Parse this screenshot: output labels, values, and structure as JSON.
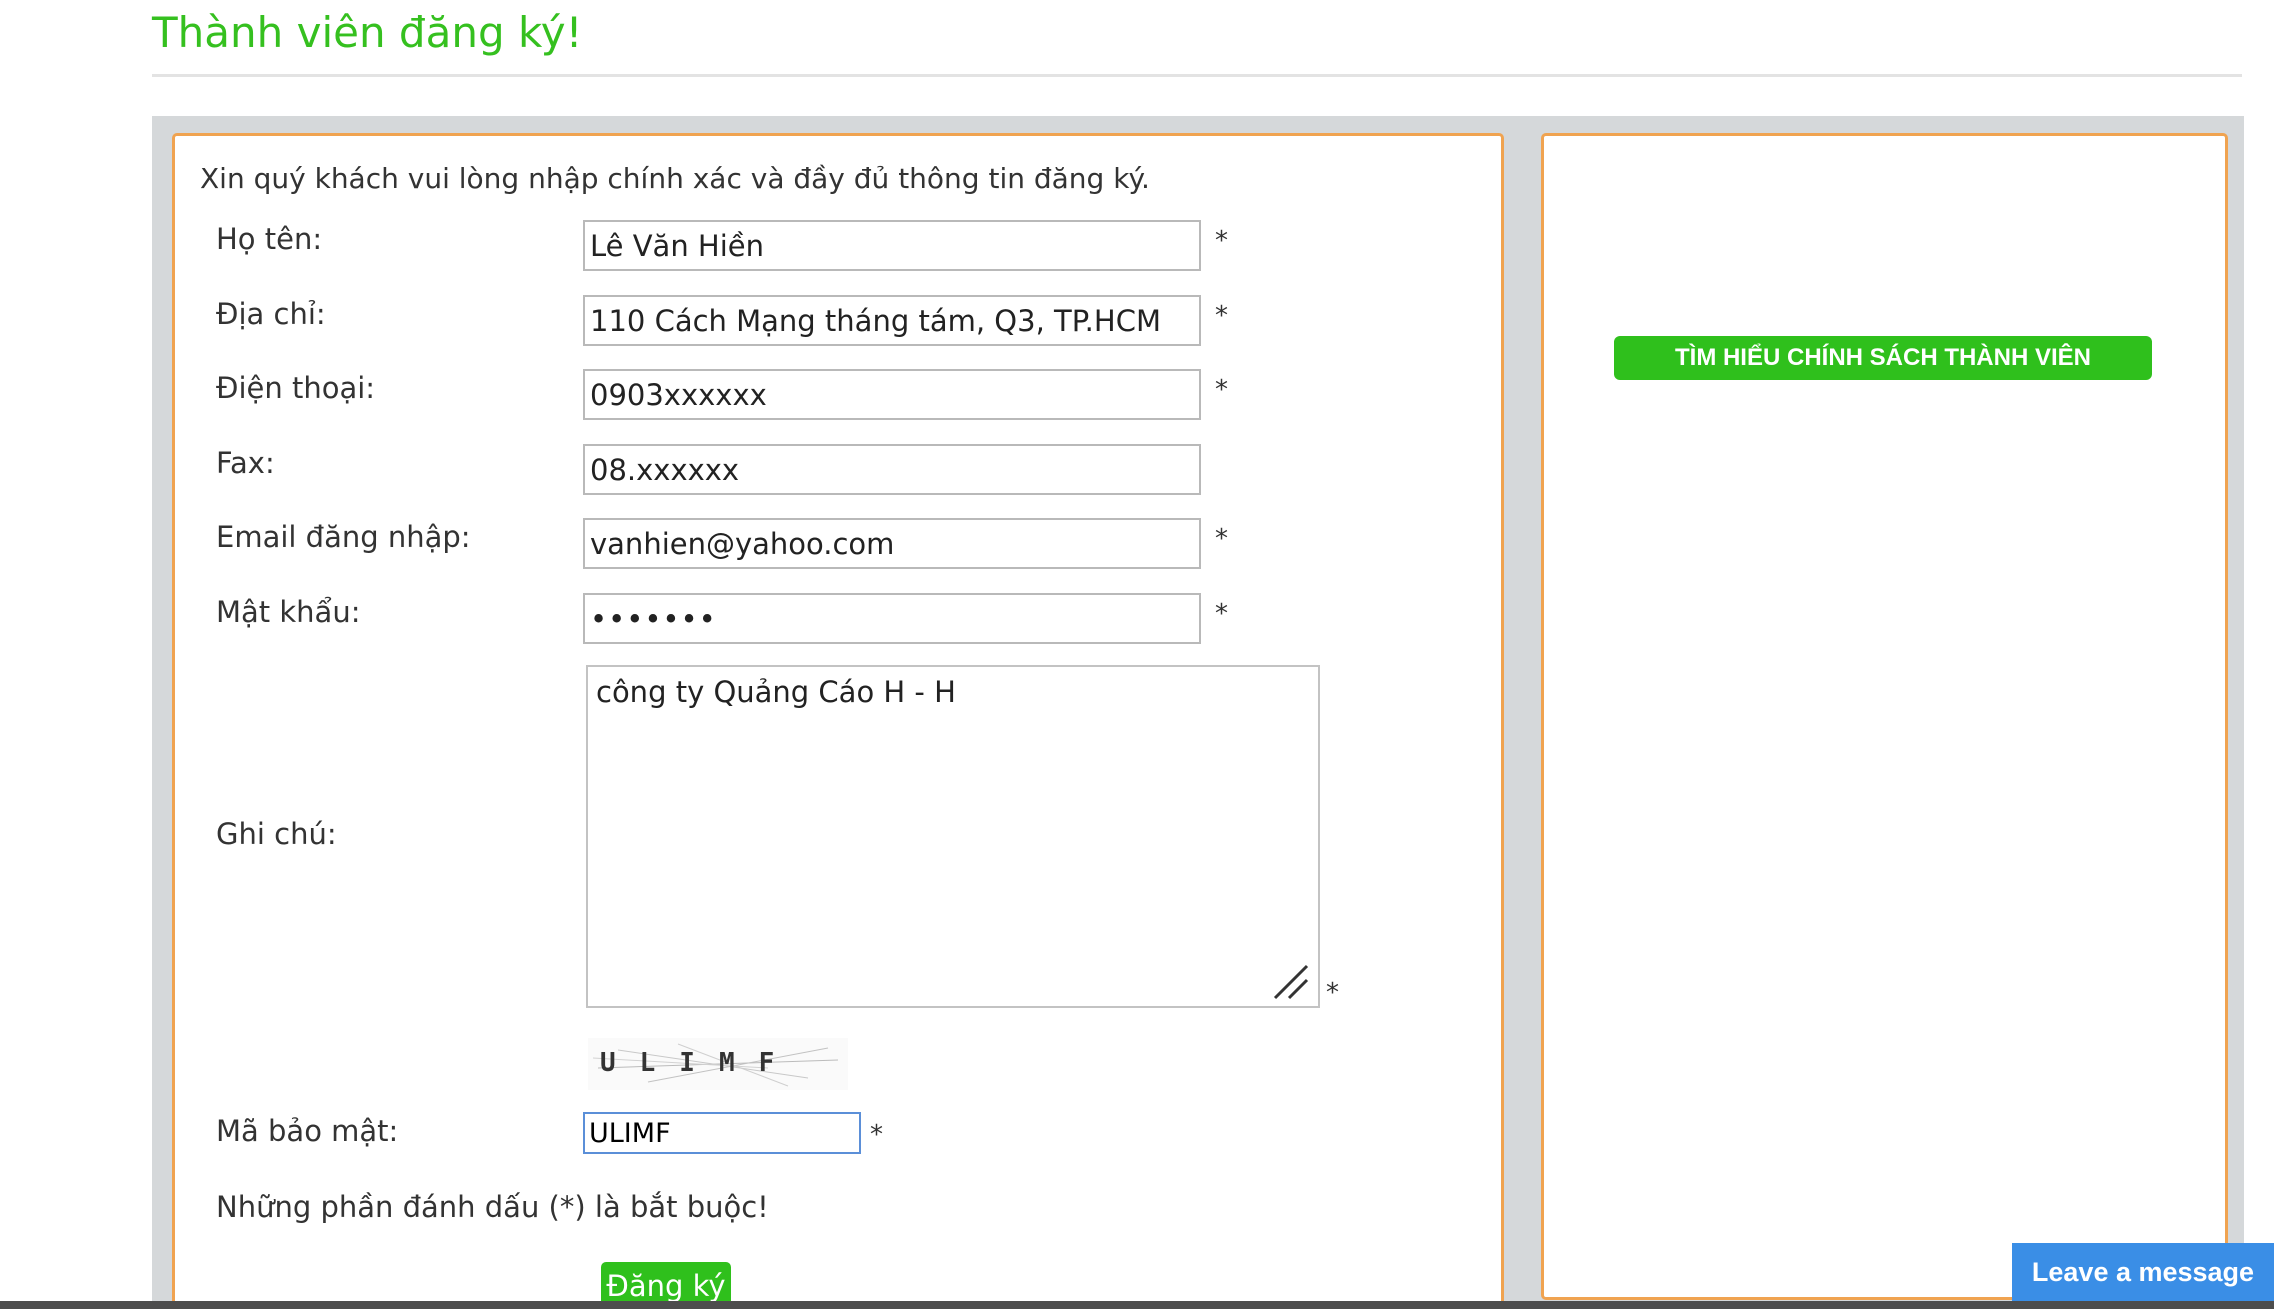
{
  "page": {
    "title": "Thành viên đăng ký!"
  },
  "form": {
    "intro": "Xin quý khách vui lòng nhập chính xác và đầy đủ thông tin đăng ký.",
    "required_mark": "*",
    "fields": {
      "name": {
        "label": "Họ tên:",
        "value": "Lê Văn Hiền"
      },
      "address": {
        "label": "Địa chỉ:",
        "value": "110 Cách Mạng tháng tám, Q3, TP.HCM"
      },
      "phone": {
        "label": "Điện thoại:",
        "value": "0903xxxxxx"
      },
      "fax": {
        "label": "Fax:",
        "value": "08.xxxxxx"
      },
      "email": {
        "label": "Email đăng nhập:",
        "value": "vanhien@yahoo.com"
      },
      "password": {
        "label": "Mật khẩu:",
        "value": "•••••••"
      },
      "notes": {
        "label": "Ghi chú:",
        "value": "công ty Quảng Cáo H - H"
      },
      "captcha": {
        "label": "Mã bảo mật:",
        "image_text": "ULIMF",
        "value": "ULIMF"
      }
    },
    "mandatory_note": "Những phần đánh dấu (*) là bắt buộc!",
    "submit_label": "Đăng ký"
  },
  "sidebar": {
    "policy_button_label": "TÌM HIỂU CHÍNH SÁCH THÀNH VIÊN"
  },
  "chat_widget": {
    "label": "Leave a message"
  },
  "colors": {
    "accent_green": "#2fc01c",
    "panel_border": "#f0a350",
    "chat_blue": "#3a8ee6"
  },
  "icons": {
    "notes_resize": "resize-grip-icon"
  }
}
